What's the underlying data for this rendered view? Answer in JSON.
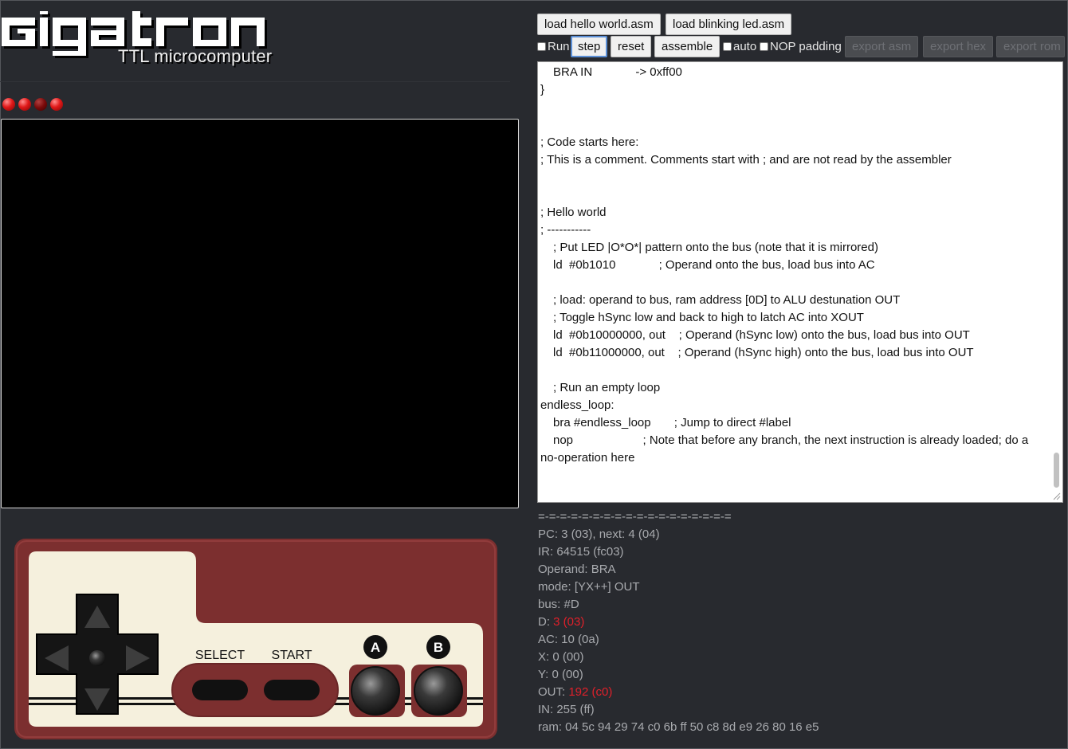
{
  "logo": {
    "title": "gigatron",
    "subtitle": "TTL microcomputer"
  },
  "leds": [
    true,
    true,
    false,
    true
  ],
  "toolbar": {
    "load_hello": "load hello world.asm",
    "load_blinking": "load blinking led.asm",
    "run_label": "Run",
    "run_checked": false,
    "step": "step",
    "reset": "reset",
    "assemble": "assemble",
    "auto_label": "auto",
    "auto_checked": false,
    "nop_label": "NOP padding",
    "nop_checked": false,
    "export_asm": "export asm",
    "export_hex": "export hex",
    "export_rom": "export rom"
  },
  "editor": {
    "lines": [
      "BRA IN             -> 0xff00",
      "}",
      "",
      "",
      "; Code starts here:",
      "; This is a comment. Comments start with ; and are not read by the assembler",
      "",
      "",
      "; Hello world",
      "; -----------",
      "; Put LED |O*O*| pattern onto the bus (note that it is mirrored)",
      "ld  #0b1010             ; Operand onto the bus, load bus into AC",
      "",
      "; load: operand to bus, ram address [0D] to ALU destunation OUT",
      "; Toggle hSync low and back to high to latch AC into XOUT",
      "ld  #0b10000000, out    ; Operand (hSync low) onto the bus, load bus into OUT",
      "ld  #0b11000000, out    ; Operand (hSync high) onto the bus, load bus into OUT",
      "",
      "; Run an empty loop",
      "endless_loop:",
      "bra #endless_loop       ; Jump to direct #label",
      "nop                     ; Note that before any branch, the next instruction is already loaded; do a",
      "no-operation here"
    ]
  },
  "state": {
    "separator": "=-=-=-=-=-=-=-=-=-=-=-=-=-=-=-=-=-=",
    "pc": "PC: 3 (03), next: 4 (04)",
    "ir": "IR: 64515 (fc03)",
    "operand": "Operand: BRA",
    "mode": "mode: [YX++] OUT",
    "bus": "bus: #D",
    "d_label": "D:",
    "d_value": "3 (03)",
    "ac": "AC: 10 (0a)",
    "x": "X: 0 (00)",
    "y": "Y: 0 (00)",
    "out_label": "OUT:",
    "out_value": "192 (c0)",
    "in": "IN: 255 (ff)",
    "ram": "ram: 04 5c 94 29 74 c0 6b ff 50 c8 8d e9 26 80 16 e5"
  },
  "gamepad": {
    "select": "SELECT",
    "start": "START",
    "a": "A",
    "b": "B"
  },
  "colors": {
    "background": "#282a2f",
    "gamepad_red": "#7c2f2f",
    "gamepad_cream": "#f5f0dd",
    "highlight": "#e0202a",
    "led": "#e01818"
  }
}
